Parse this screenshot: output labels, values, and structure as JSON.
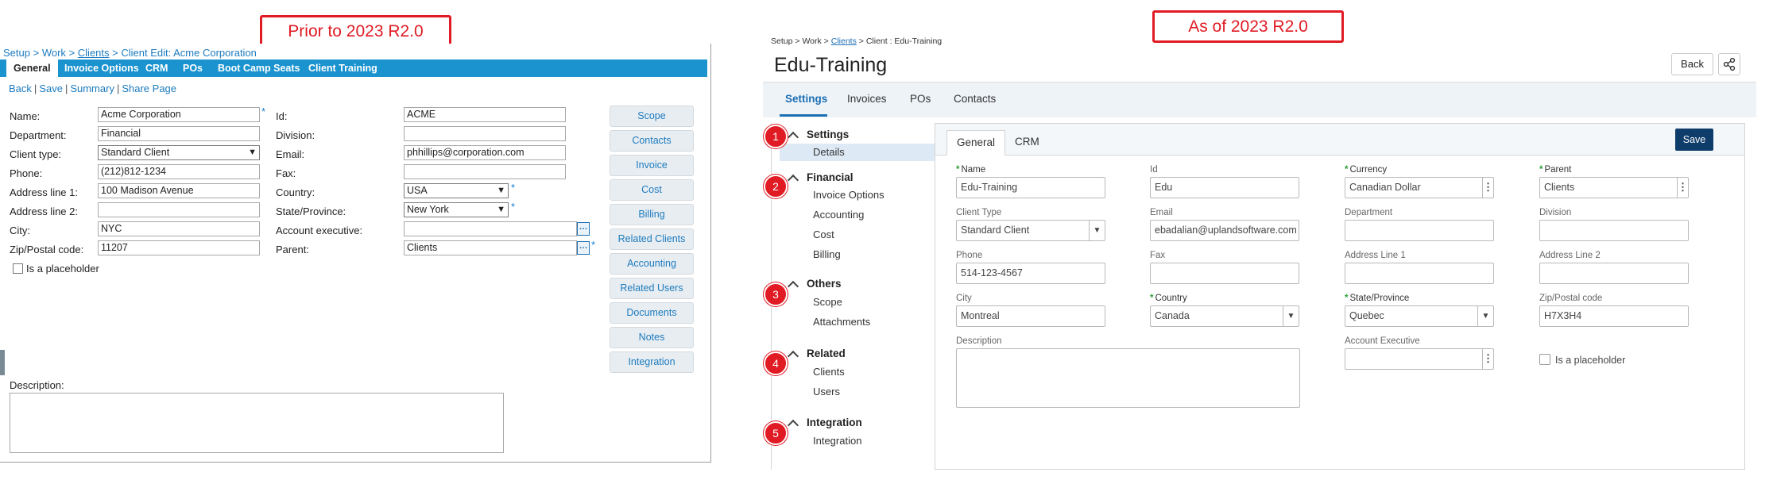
{
  "labels": {
    "before": "Prior to 2023 R2.0",
    "after": "As of 2023 R2.0"
  },
  "old": {
    "breadcrumb": {
      "setup": "Setup",
      "work": "Work",
      "clients": "Clients",
      "current": "Client Edit: Acme Corporation",
      "sep": ">"
    },
    "tabs": [
      "General",
      "Invoice Options",
      "CRM",
      "POs",
      "Boot Camp Seats",
      "Client Training"
    ],
    "actions": [
      "Back",
      "Save",
      "Summary",
      "Share Page"
    ],
    "fields": {
      "name": {
        "label": "Name:",
        "value": "Acme Corporation"
      },
      "department": {
        "label": "Department:",
        "value": "Financial"
      },
      "client_type": {
        "label": "Client type:",
        "value": "Standard Client"
      },
      "phone": {
        "label": "Phone:",
        "value": "(212)812-1234"
      },
      "address1": {
        "label": "Address line 1:",
        "value": "100 Madison Avenue"
      },
      "address2": {
        "label": "Address line 2:",
        "value": ""
      },
      "city": {
        "label": "City:",
        "value": "NYC"
      },
      "zip": {
        "label": "Zip/Postal code:",
        "value": "11207"
      },
      "id": {
        "label": "Id:",
        "value": "ACME"
      },
      "division": {
        "label": "Division:",
        "value": ""
      },
      "email": {
        "label": "Email:",
        "value": "phhillips@corporation.com"
      },
      "fax": {
        "label": "Fax:",
        "value": ""
      },
      "country": {
        "label": "Country:",
        "value": "USA"
      },
      "state": {
        "label": "State/Province:",
        "value": "New York"
      },
      "account_exec": {
        "label": "Account executive:",
        "value": ""
      },
      "parent": {
        "label": "Parent:",
        "value": "Clients"
      },
      "placeholder": {
        "label": "Is a placeholder"
      },
      "description": {
        "label": "Description:"
      }
    },
    "required_mark": "*",
    "side_buttons": [
      "Scope",
      "Contacts",
      "Invoice",
      "Cost",
      "Billing",
      "Related Clients",
      "Accounting",
      "Related Users",
      "Documents",
      "Notes",
      "Integration"
    ]
  },
  "new": {
    "breadcrumb": {
      "setup": "Setup",
      "work": "Work",
      "clients": "Clients",
      "current": "Client : Edu-Training",
      "sep": ">"
    },
    "title": "Edu-Training",
    "back": "Back",
    "tabs": [
      "Settings",
      "Invoices",
      "POs",
      "Contacts"
    ],
    "groups": [
      {
        "num": "1",
        "title": "Settings",
        "items": [
          "Details"
        ]
      },
      {
        "num": "2",
        "title": "Financial",
        "items": [
          "Invoice Options",
          "Accounting",
          "Cost",
          "Billing"
        ]
      },
      {
        "num": "3",
        "title": "Others",
        "items": [
          "Scope",
          "Attachments"
        ]
      },
      {
        "num": "4",
        "title": "Related",
        "items": [
          "Clients",
          "Users"
        ]
      },
      {
        "num": "5",
        "title": "Integration",
        "items": [
          "Integration"
        ]
      }
    ],
    "subtabs": [
      "General",
      "CRM"
    ],
    "save": "Save",
    "fields": {
      "name": {
        "label": "Name",
        "value": "Edu-Training"
      },
      "id": {
        "label": "Id",
        "value": "Edu"
      },
      "currency": {
        "label": "Currency",
        "value": "Canadian Dollar"
      },
      "parent": {
        "label": "Parent",
        "value": "Clients"
      },
      "client_type": {
        "label": "Client Type",
        "value": "Standard Client"
      },
      "email": {
        "label": "Email",
        "value": "ebadalian@uplandsoftware.com"
      },
      "department": {
        "label": "Department",
        "value": ""
      },
      "division": {
        "label": "Division",
        "value": ""
      },
      "phone": {
        "label": "Phone",
        "value": "514-123-4567"
      },
      "fax": {
        "label": "Fax",
        "value": ""
      },
      "address1": {
        "label": "Address Line 1",
        "value": ""
      },
      "address2": {
        "label": "Address Line 2",
        "value": ""
      },
      "city": {
        "label": "City",
        "value": "Montreal"
      },
      "country": {
        "label": "Country",
        "value": "Canada"
      },
      "state": {
        "label": "State/Province",
        "value": "Quebec"
      },
      "zip": {
        "label": "Zip/Postal code",
        "value": "H7X3H4"
      },
      "description": {
        "label": "Description"
      },
      "account_exec": {
        "label": "Account Executive",
        "value": ""
      },
      "placeholder": {
        "label": "Is a placeholder"
      }
    },
    "required_mark": "*"
  },
  "colors": {
    "accent_red": "#e01b24",
    "old_tab_blue": "#1a93cf",
    "new_brand": "#0f3d6b",
    "link_blue": "#1d6fb5"
  }
}
